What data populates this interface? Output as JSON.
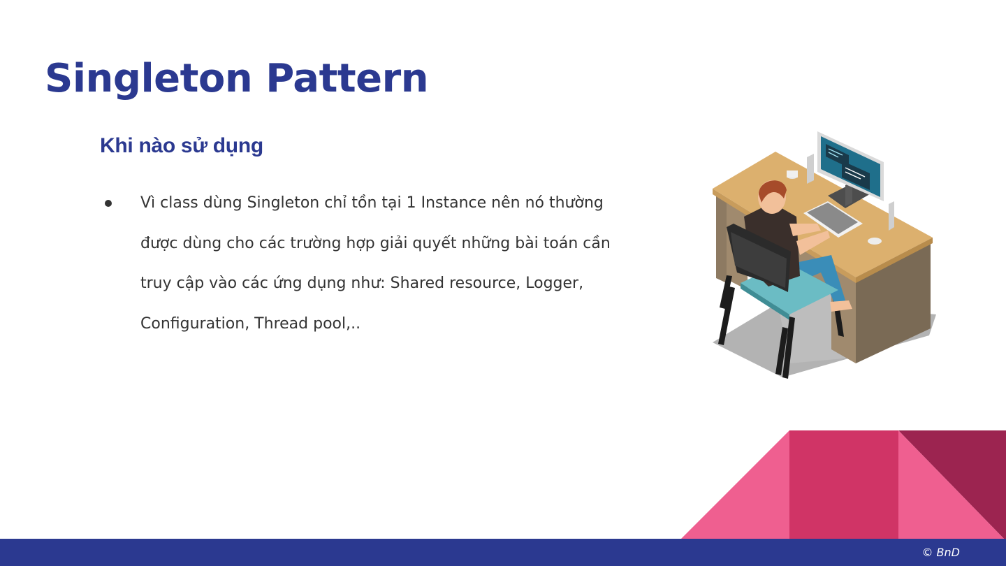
{
  "slide": {
    "title": "Singleton Pattern",
    "section_heading": "Khi nào sử dụng",
    "bullets": [
      "Vì class dùng Singleton chỉ tồn tại 1 Instance nên nó thường được dùng cho các trường hợp giải quyết những bài toán cần truy cập vào các ứng dụng như: Shared resource, Logger, Configuration, Thread pool,.."
    ]
  },
  "footer": {
    "copyright": "© BnD"
  },
  "colors": {
    "brand_navy": "#2b3990",
    "pink": "#ef5f90",
    "magenta": "#d03466",
    "maroon": "#9c2450",
    "body_text": "#333333"
  },
  "icons": [
    "developer-at-desk-illustration",
    "bullet-dot"
  ]
}
